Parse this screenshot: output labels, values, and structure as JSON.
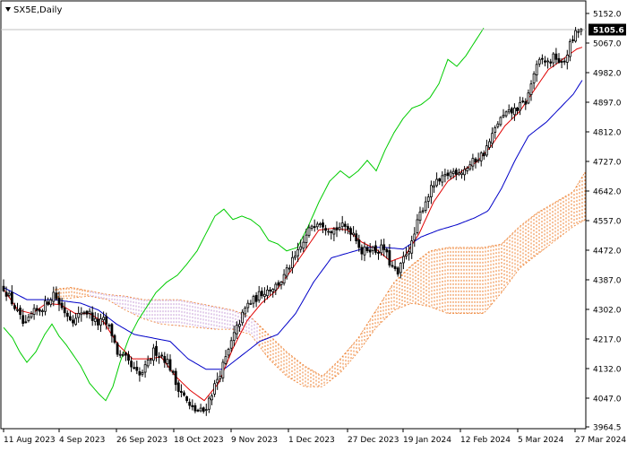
{
  "chart_data": {
    "type": "candlestick",
    "title": "SX5E,Daily",
    "last_price_label": "5105.6",
    "y_axis": {
      "ticks": [
        "5152.0",
        "5067.0",
        "4982.0",
        "4897.0",
        "4812.0",
        "4727.0",
        "4642.0",
        "4557.0",
        "4472.0",
        "4387.0",
        "4302.0",
        "4217.0",
        "4132.0",
        "4047.0",
        "3964.5"
      ],
      "range": [
        3964.5,
        5152.0
      ]
    },
    "x_axis": {
      "ticks": [
        "11 Aug 2023",
        "4 Sep 2023",
        "26 Sep 2023",
        "18 Oct 2023",
        "9 Nov 2023",
        "1 Dec 2023",
        "27 Dec 2023",
        "19 Jan 2024",
        "12 Feb 2024",
        "5 Mar 2024",
        "27 Mar 2024"
      ]
    },
    "indicators": [
      "Ichimoku Kinko Hyo: Tenkan-sen (red), Kijun-sen (blue), Chikou Span (green), Kumo cloud (orange / violet hatched)"
    ],
    "key_levels": {
      "current_price": 5105.6,
      "tenkan_end": 5055,
      "kijun_end": 4960,
      "cloud_top_end": 4735,
      "cloud_bottom_end": 4620
    },
    "colors": {
      "tenkan": "#e00000",
      "kijun": "#0000c8",
      "chikou": "#00cc00",
      "cloud_up": "#ee8030",
      "cloud_down": "#c8a0d8",
      "candle": "#000000"
    }
  }
}
